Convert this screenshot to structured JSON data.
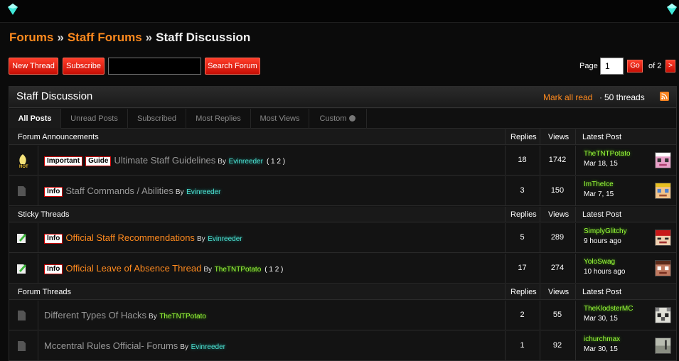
{
  "breadcrumb": {
    "forums": "Forums",
    "sep1": "»",
    "staff_forums": "Staff Forums",
    "sep2": "»",
    "current": "Staff Discussion"
  },
  "toolbar": {
    "new_thread": "New Thread",
    "subscribe": "Subscribe",
    "search_value": "",
    "search_forum": "Search Forum",
    "page_label": "Page",
    "page_value": "1",
    "go": "Go",
    "of_pages": "of 2",
    "next": ">"
  },
  "panel": {
    "title": "Staff Discussion",
    "mark_all_read": "Mark all read",
    "dot": "·",
    "thread_count": "50 threads"
  },
  "tabs": [
    "All Posts",
    "Unread Posts",
    "Subscribed",
    "Most Replies",
    "Most Views",
    "Custom"
  ],
  "sections": [
    {
      "name": "Forum Announcements",
      "replies": "Replies",
      "views": "Views",
      "last_post": "Latest Post",
      "threads": [
        {
          "prefixes": [
            "Important",
            "Guide"
          ],
          "title": "Ultimate Staff Guidelines",
          "by": "By",
          "author": "Evinreeder",
          "pages": "( 1 2 )",
          "replies": "18",
          "views": "1742",
          "last_user": "TheTNTPotato",
          "last_date": "Mar 18, 15"
        },
        {
          "prefixes": [
            "Info"
          ],
          "title": "Staff Commands / Abilities",
          "by": "By",
          "author": "Evinreeder",
          "pages": "",
          "replies": "3",
          "views": "150",
          "last_user": "ImTheIce",
          "last_date": "Mar 7, 15"
        }
      ]
    },
    {
      "name": "Sticky Threads",
      "replies": "Replies",
      "views": "Views",
      "last_post": "Latest Post",
      "threads": [
        {
          "prefixes": [
            "Info"
          ],
          "title": "Official Staff Recommendations",
          "by": "By",
          "author": "Evinreeder",
          "pages": "",
          "replies": "5",
          "views": "289",
          "last_user": "SimplyGlitchy",
          "last_date": "9 hours ago"
        },
        {
          "prefixes": [
            "Info"
          ],
          "title": "Official Leave of Absence Thread",
          "by": "By",
          "author": "TheTNTPotato",
          "pages": "( 1 2 )",
          "replies": "17",
          "views": "274",
          "last_user": "YoloSwag",
          "last_date": "10 hours ago"
        }
      ]
    },
    {
      "name": "Forum Threads",
      "replies": "Replies",
      "views": "Views",
      "last_post": "Latest Post",
      "threads": [
        {
          "prefixes": [],
          "title": "Different Types Of Hacks",
          "by": "By",
          "author": "TheTNTPotato",
          "pages": "",
          "replies": "2",
          "views": "55",
          "last_user": "TheKlodsterMC",
          "last_date": "Mar 30, 15"
        },
        {
          "prefixes": [],
          "title": "Mccentral Rules Official- Forums",
          "by": "By",
          "author": "Evinreeder",
          "pages": "",
          "replies": "1",
          "views": "92",
          "last_user": "ichurchmax",
          "last_date": "Mar 30, 15"
        }
      ]
    }
  ],
  "colors": {
    "accent": "#ff8a1e",
    "button_red": "#e0200f",
    "author_teal": "#4de0d0",
    "author_green": "#9cff3a"
  }
}
